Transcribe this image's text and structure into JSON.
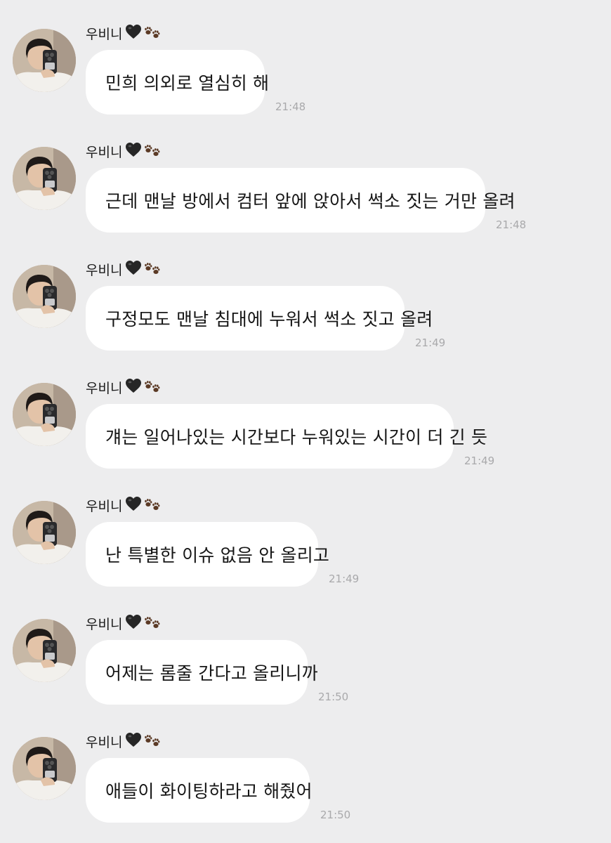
{
  "messages": [
    {
      "sender": "우비니",
      "text": "민희 의외로 열심히 해",
      "time": "21:48"
    },
    {
      "sender": "우비니",
      "text": "근데 맨날 방에서 컴터 앞에 앉아서 썩소 짓는 거만 올려",
      "time": "21:48"
    },
    {
      "sender": "우비니",
      "text": "구정모도 맨날 침대에 누워서 썩소 짓고 올려",
      "time": "21:49"
    },
    {
      "sender": "우비니",
      "text": "걔는 일어나있는 시간보다 누워있는 시간이 더 긴 듯",
      "time": "21:49"
    },
    {
      "sender": "우비니",
      "text": "난 특별한 이슈 없음 안 올리고",
      "time": "21:49"
    },
    {
      "sender": "우비니",
      "text": "어제는 롬줄 간다고 올리니까",
      "time": "21:50"
    },
    {
      "sender": "우비니",
      "text": "애들이 화이팅하라고 해줬어",
      "time": "21:50"
    }
  ],
  "sender_emoji": [
    "black-heart-icon",
    "paw-prints-icon"
  ],
  "colors": {
    "background": "#ededee",
    "bubble": "#ffffff",
    "timestamp": "#a9a9ab",
    "text": "#161616"
  }
}
